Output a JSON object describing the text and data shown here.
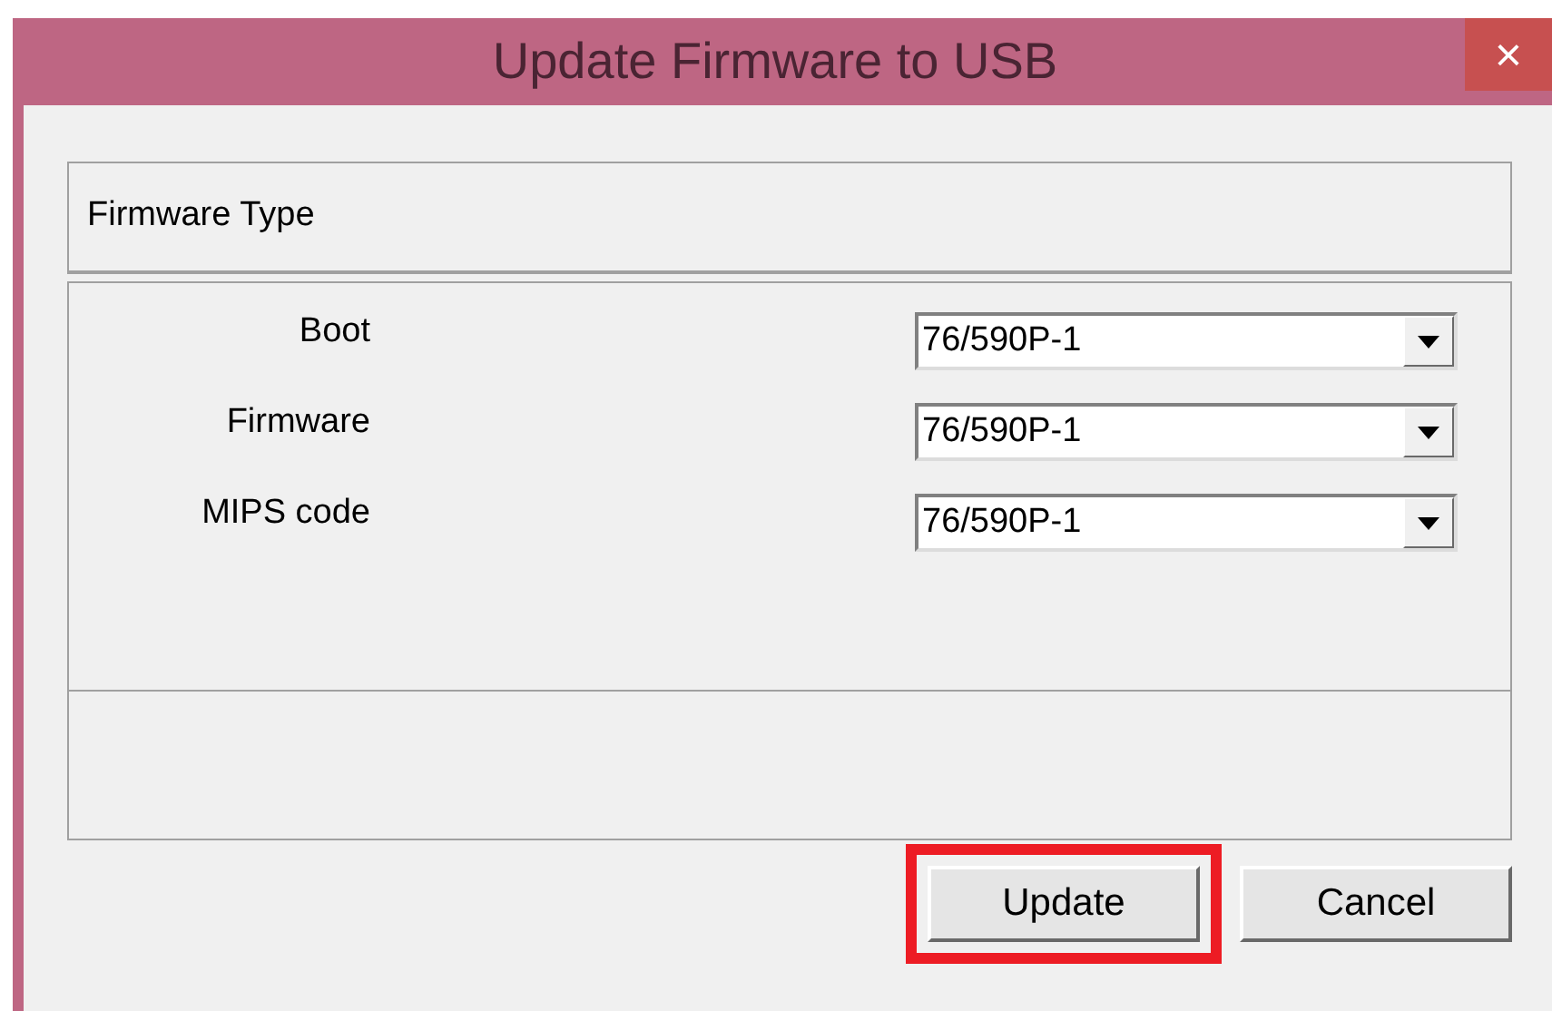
{
  "window": {
    "title": "Update Firmware to USB",
    "close": "×"
  },
  "group": {
    "title": "Firmware Type"
  },
  "fields": [
    {
      "label": "Boot",
      "value": "76/590P-1"
    },
    {
      "label": "Firmware",
      "value": "76/590P-1"
    },
    {
      "label": "MIPS code",
      "value": "76/590P-1"
    }
  ],
  "buttons": [
    {
      "label": "Update",
      "highlighted": true
    },
    {
      "label": "Cancel",
      "highlighted": false
    }
  ]
}
